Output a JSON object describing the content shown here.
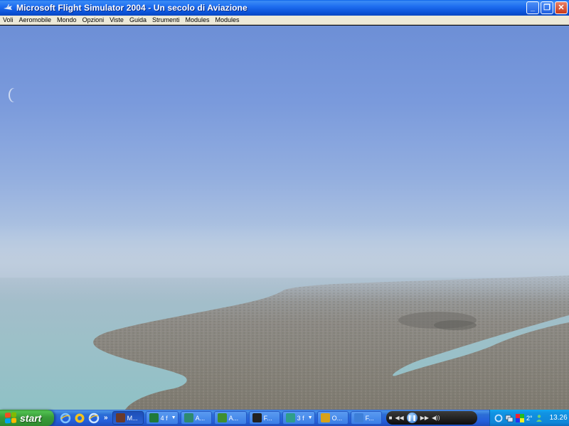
{
  "window": {
    "title": "Microsoft Flight Simulator 2004 - Un secolo di Aviazione",
    "controls": {
      "minimize": "_",
      "restore": "❐",
      "close": "✕"
    }
  },
  "menu": [
    "Voli",
    "Aeromobile",
    "Mondo",
    "Opzioni",
    "Viste",
    "Guida",
    "Strumenti",
    "Modules",
    "Modules"
  ],
  "taskbar": {
    "start_label": "start",
    "quick_launch_more": "»",
    "tasks": [
      {
        "label": "M...",
        "icon": "plane-icon",
        "color": "#6b3a2a",
        "active": true
      },
      {
        "label": "4 f",
        "icon": "excel-icon",
        "color": "#1f7a3a",
        "caret": "▼"
      },
      {
        "label": "A...",
        "icon": "app-icon",
        "color": "#2e8a6e"
      },
      {
        "label": "A...",
        "icon": "frog-icon",
        "color": "#3f8f2f"
      },
      {
        "label": "F...",
        "icon": "terminal-icon",
        "color": "#222222"
      },
      {
        "label": "3 f",
        "icon": "msn-icon",
        "color": "#2f9e8a",
        "caret": "▼"
      },
      {
        "label": "O...",
        "icon": "browser-icon",
        "color": "#d7a21a"
      },
      {
        "label": "F...",
        "icon": "ie-icon",
        "color": "#3d7fd8"
      }
    ],
    "media": {
      "stop": "■",
      "prev": "◀◀",
      "play": "❚❚",
      "next": "▶▶",
      "volume": "◀))"
    },
    "tray": {
      "temperature": "2°",
      "clock": "13.26"
    }
  },
  "colors": {
    "titlebar": "#0a52d8",
    "taskbar": "#245edb",
    "start": "#3a9e3a",
    "tray": "#0f86d8"
  }
}
